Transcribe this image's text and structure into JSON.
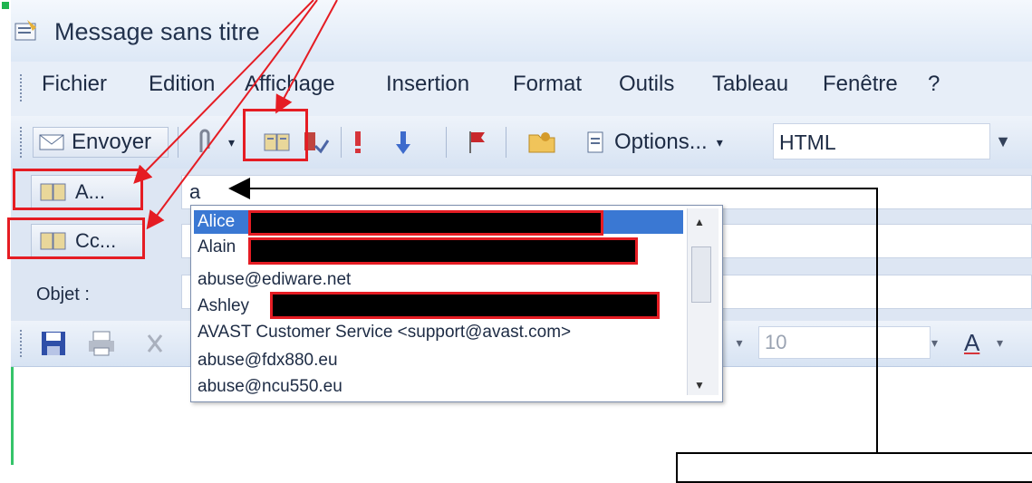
{
  "window": {
    "title": "Message sans titre"
  },
  "menu": [
    "Fichier",
    "Edition",
    "Affichage",
    "Insertion",
    "Format",
    "Outils",
    "Tableau",
    "Fenêtre",
    "?"
  ],
  "toolbar": {
    "send_label": "Envoyer",
    "options_label": "Options...",
    "format_value": "HTML"
  },
  "fields": {
    "to_button": "A...",
    "cc_button": "Cc...",
    "subject_label": "Objet :",
    "to_value": "a"
  },
  "format_toolbar": {
    "font_size": "10"
  },
  "autocomplete": [
    "Alice",
    "Alain",
    "abuse@ediware.net",
    "Ashley",
    "AVAST Customer Service   <support@avast.com>",
    "abuse@fdx880.eu",
    "abuse@ncu550.eu"
  ],
  "colors": {
    "annotation_red": "#e51c23",
    "selection": "#3a78d3",
    "window_blue": "#dde6f3"
  }
}
